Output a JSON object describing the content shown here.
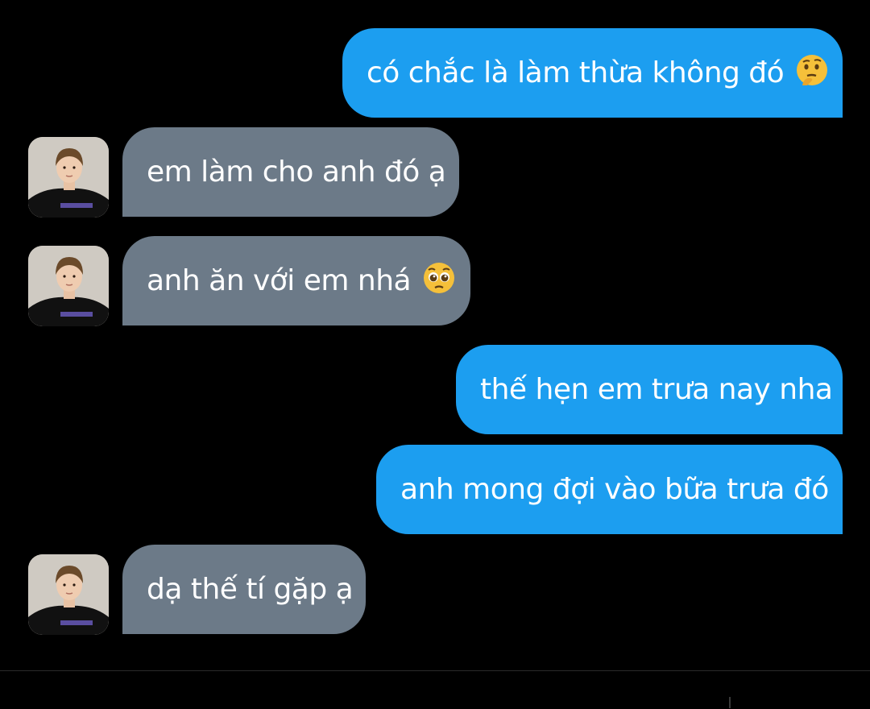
{
  "colors": {
    "background": "#000000",
    "outgoing_bubble": "#1c9ef0",
    "incoming_bubble": "#6c7a88",
    "text": "#ffffff"
  },
  "messages": [
    {
      "direction": "outgoing",
      "text": "có chắc là làm thừa không đó",
      "emoji": "thinking-face-emoji"
    },
    {
      "direction": "incoming",
      "text": "em làm cho anh đó ạ"
    },
    {
      "direction": "incoming",
      "text": "anh ăn với em nhá",
      "emoji": "pleading-face-emoji"
    },
    {
      "direction": "outgoing",
      "text": "thế hẹn em trưa nay nha"
    },
    {
      "direction": "outgoing",
      "text": "anh mong đợi vào bữa trưa đó"
    },
    {
      "direction": "incoming",
      "text": "dạ thế tí gặp ạ"
    }
  ]
}
